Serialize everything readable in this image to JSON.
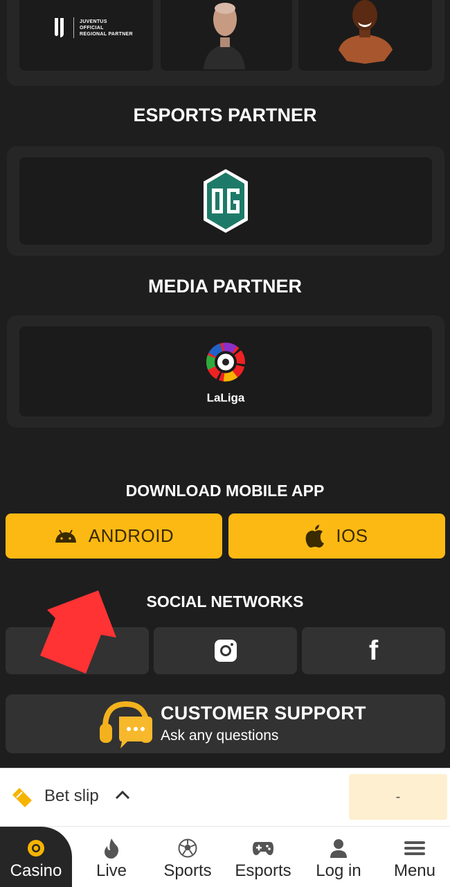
{
  "partners_top": {
    "juventus_text": "JUVENTUS\nOFFICIAL\nREGIONAL PARTNER"
  },
  "sections": {
    "esports_title": "ESPORTS PARTNER",
    "media_title": "MEDIA PARTNER",
    "download_title": "DOWNLOAD MOBILE APP",
    "social_title": "SOCIAL NETWORKS"
  },
  "media_partner": {
    "logo_text": "LaLiga"
  },
  "apps": {
    "android_label": "ANDROID",
    "ios_label": "IOS"
  },
  "social": {
    "facebook_glyph": "f"
  },
  "support": {
    "title": "CUSTOMER SUPPORT",
    "subtitle": "Ask any questions"
  },
  "betslip": {
    "label": "Bet slip",
    "value": "-"
  },
  "nav": {
    "casino": "Casino",
    "live": "Live",
    "sports": "Sports",
    "esports": "Esports",
    "login": "Log in",
    "menu": "Menu"
  },
  "colors": {
    "background": "#1e1e1e",
    "card": "#262626",
    "accent": "#fdb913",
    "overlay_arrow": "#ff3333"
  },
  "icons": [
    "android-icon",
    "apple-icon",
    "instagram-icon",
    "facebook-icon",
    "headset-icon",
    "ticket-icon",
    "chevron-up-icon",
    "casino-chip-icon",
    "flame-icon",
    "soccer-ball-icon",
    "gamepad-icon",
    "user-icon",
    "hamburger-icon"
  ]
}
